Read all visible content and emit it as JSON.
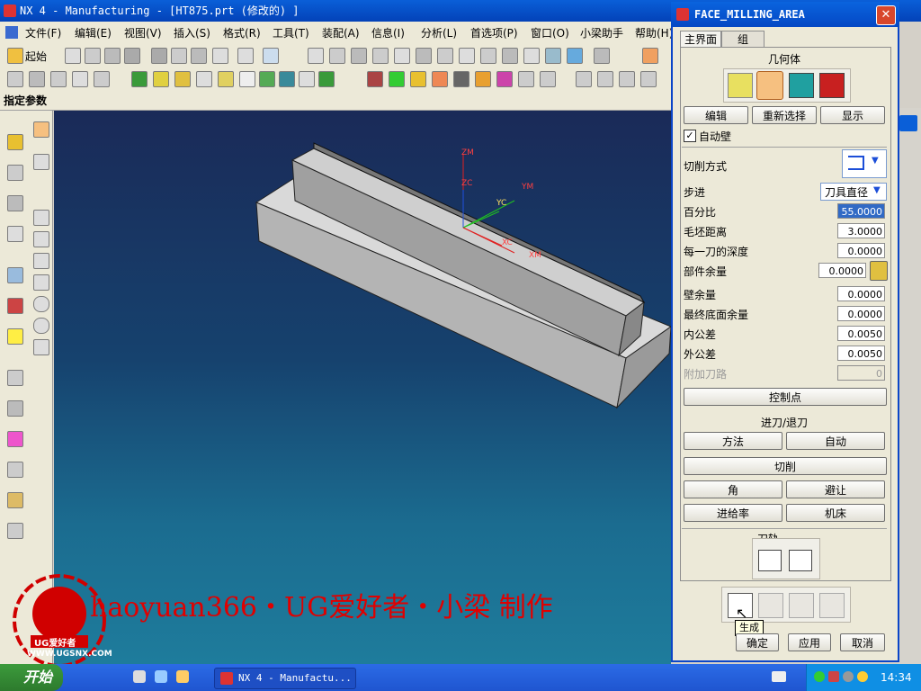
{
  "window": {
    "title": "NX 4 - Manufacturing - [HT875.prt (修改的) ]"
  },
  "menubar": [
    "文件(F)",
    "编辑(E)",
    "视图(V)",
    "插入(S)",
    "格式(R)",
    "工具(T)",
    "装配(A)",
    "信息(I)",
    "分析(L)",
    "首选项(P)",
    "窗口(O)",
    "小梁助手",
    "帮助(H)"
  ],
  "toolbar": {
    "start_label": "起始"
  },
  "cue": {
    "text": "指定参数"
  },
  "viewport": {
    "axis_labels": {
      "zm": "ZM",
      "zc": "ZC",
      "ym": "YM",
      "yc": "YC",
      "xc": "XC",
      "xm": "XM"
    }
  },
  "dialog": {
    "title": "FACE_MILLING_AREA",
    "close_label": "✕",
    "tabs": [
      "主界面",
      "组"
    ],
    "geometry_heading": "几何体",
    "geom_buttons": [
      "编辑",
      "重新选择",
      "显示"
    ],
    "auto_wall_label": "自动壁",
    "auto_wall_checked": true,
    "cut_method_label": "切削方式",
    "stepover_label": "步进",
    "stepover_value": "刀具直径",
    "params": [
      {
        "label": "百分比",
        "value": "55.0000",
        "highlight": true
      },
      {
        "label": "毛坯距离",
        "value": "3.0000"
      },
      {
        "label": "每一刀的深度",
        "value": "0.0000"
      }
    ],
    "part_stock": {
      "label": "部件余量",
      "value": "0.0000"
    },
    "params2": [
      {
        "label": "壁余量",
        "value": "0.0000"
      },
      {
        "label": "最终底面余量",
        "value": "0.0000"
      },
      {
        "label": "内公差",
        "value": "0.0050"
      },
      {
        "label": "外公差",
        "value": "0.0050"
      },
      {
        "label": "附加刀路",
        "value": "0",
        "disabled": true
      }
    ],
    "control_points": "控制点",
    "engage_heading": "进刀/退刀",
    "engage_buttons": [
      "方法",
      "自动"
    ],
    "cutting_button": "切削",
    "corner_button": "角",
    "avoid_button": "避让",
    "feed_button": "进给率",
    "machine_button": "机床",
    "toolpath_heading": "刀轨",
    "tooltip": "生成",
    "ok": "确定",
    "apply": "应用",
    "cancel": "取消"
  },
  "watermark": {
    "text": "haoyuan366・UG爱好者・小梁 制作",
    "logo_text": "UG爱好者",
    "url": "WWW.UGSNX.COM"
  },
  "taskbar": {
    "start": "开始",
    "task": "NX 4 - Manufactu...",
    "clock": "14:34"
  }
}
